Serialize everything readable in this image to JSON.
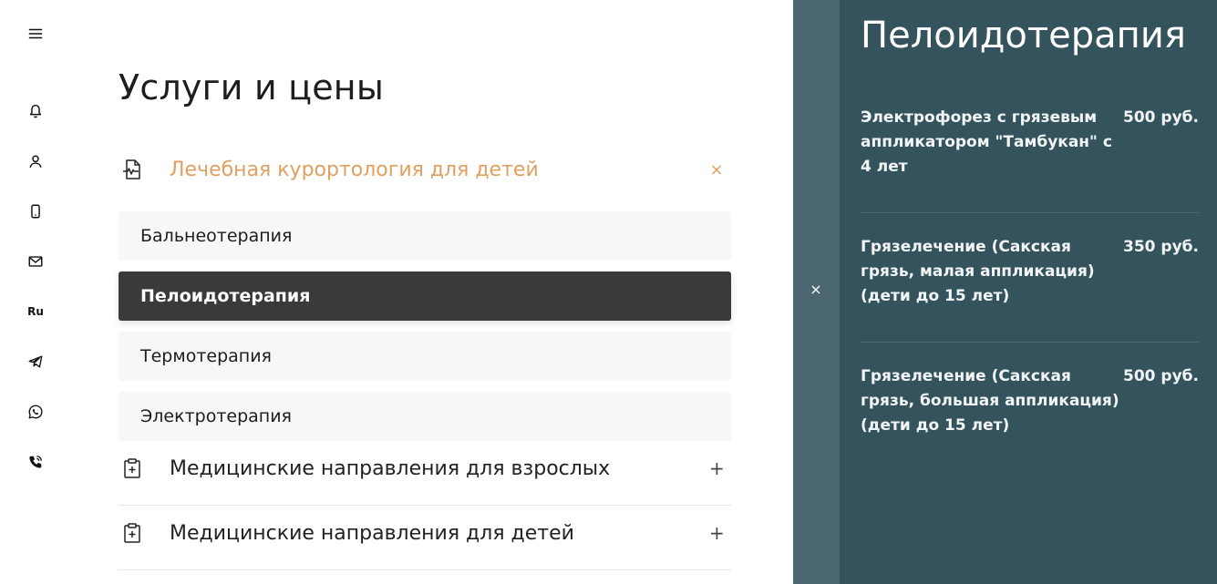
{
  "rail": {
    "menu_icon": "hamburger-icon",
    "items": [
      {
        "name": "bell-icon"
      },
      {
        "name": "user-icon"
      },
      {
        "name": "phone-device-icon"
      },
      {
        "name": "mail-icon"
      },
      {
        "name": "language",
        "label": "Ru"
      },
      {
        "name": "telegram-icon"
      },
      {
        "name": "whatsapp-icon"
      },
      {
        "name": "phone-call-icon"
      }
    ]
  },
  "main": {
    "title": "Услуги и цены",
    "categories": [
      {
        "label": "Лечебная курортология для детей",
        "toggle": "×",
        "expanded": true,
        "sub_items": [
          {
            "label": "Бальнеотерапия"
          },
          {
            "label": "Пелоидотерапия",
            "active": true
          },
          {
            "label": "Термотерапия"
          },
          {
            "label": "Электротерапия"
          }
        ]
      },
      {
        "label": "Медицинские направления для взрослых",
        "toggle": "+"
      },
      {
        "label": "Медицинские направления для детей",
        "toggle": "+"
      }
    ]
  },
  "panel": {
    "close": "×",
    "title": "Пелоидотерапия",
    "items": [
      {
        "name": "Электрофорез с грязевым аппликатором \"Тамбукан\" с 4 лет",
        "price": "500 руб."
      },
      {
        "name": "Грязелечение (Сакская грязь, малая аппликация) (дети до 15 лет)",
        "price": "350 руб."
      },
      {
        "name": "Грязелечение (Сакская грязь, большая аппликация) (дети до 15 лет)",
        "price": "500 руб."
      }
    ]
  },
  "colors": {
    "accent": "#e0a060",
    "panel_bg": "#35535c",
    "panel_strip": "#4b6870",
    "active_item_bg": "#3a3a3a"
  }
}
